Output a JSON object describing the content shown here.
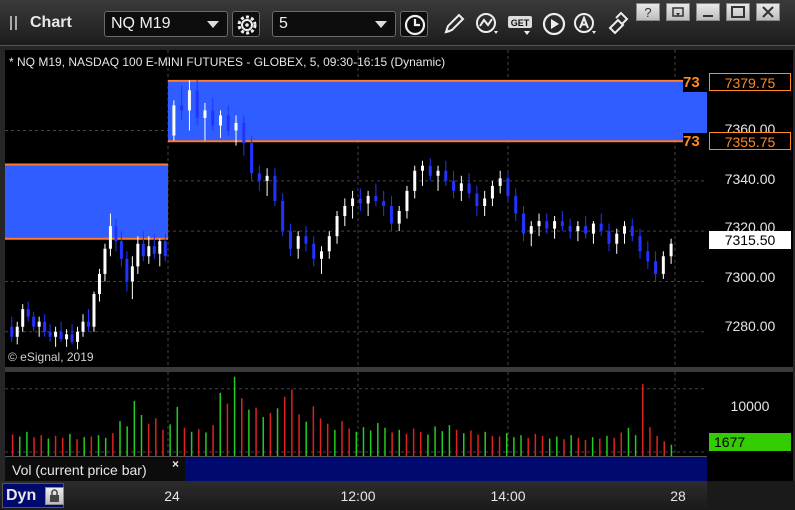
{
  "window": {
    "title": "Chart"
  },
  "toolbar": {
    "symbol": "NQ M19",
    "interval": "5"
  },
  "chart": {
    "description": "* NQ M19, NASDAQ 100 E-MINI FUTURES - GLOBEX, 5, 09:30-16:15 (Dynamic)",
    "copyright": "© eSignal, 2019",
    "price_axis": [
      "7360.00",
      "7340.00",
      "7320.00",
      "7300.00",
      "7280.00"
    ],
    "price_tags": {
      "zone_top": "7379.75",
      "zone_bottom": "7355.75",
      "last": "7315.50",
      "left_marker_top": "73",
      "left_marker_bottom": "73"
    },
    "volume": {
      "label": "Vol (current price bar)",
      "axis_label": "10000",
      "last": "1677",
      "close_symbol": "×"
    },
    "time_axis": [
      "24",
      "12:00",
      "14:00",
      "28"
    ],
    "dyn_label": "Dyn"
  },
  "colors": {
    "up": "#ffffff",
    "down": "#2233ff",
    "zone": "#2f5dff",
    "zone_line": "#ff7a2a",
    "vol_up": "#22cc22",
    "vol_down": "#dd2222",
    "last_vol_tag": "#33cc00"
  },
  "chart_data": {
    "type": "candlestick",
    "title": "* NQ M19, NASDAQ 100 E-MINI FUTURES - GLOBEX, 5, 09:30-16:15 (Dynamic)",
    "y_ticks": [
      7280,
      7300,
      7320,
      7340,
      7360
    ],
    "ylim": [
      7266,
      7392
    ],
    "zones": [
      {
        "top": 7379.75,
        "bottom": 7355.75,
        "x_start": 0.234,
        "x_end": 1.0
      },
      {
        "top": 7346.5,
        "bottom": 7317,
        "x_start": 0.0,
        "x_end": 0.234
      }
    ],
    "last_price": 7315.5,
    "ohlc": [
      [
        7282,
        7286,
        7276,
        7278
      ],
      [
        7278,
        7284,
        7275,
        7282
      ],
      [
        7282,
        7291,
        7280,
        7289
      ],
      [
        7289,
        7292,
        7284,
        7286
      ],
      [
        7286,
        7288,
        7280,
        7282
      ],
      [
        7282,
        7286,
        7278,
        7284
      ],
      [
        7284,
        7287,
        7278,
        7280
      ],
      [
        7280,
        7283,
        7276,
        7278
      ],
      [
        7278,
        7282,
        7274,
        7280
      ],
      [
        7280,
        7284,
        7276,
        7277
      ],
      [
        7277,
        7281,
        7274,
        7279
      ],
      [
        7279,
        7283,
        7275,
        7276
      ],
      [
        7276,
        7282,
        7273,
        7280
      ],
      [
        7280,
        7287,
        7278,
        7284
      ],
      [
        7284,
        7289,
        7280,
        7282
      ],
      [
        7282,
        7296,
        7280,
        7295
      ],
      [
        7295,
        7305,
        7292,
        7303
      ],
      [
        7303,
        7315,
        7300,
        7313
      ],
      [
        7313,
        7327,
        7310,
        7322
      ],
      [
        7322,
        7325,
        7312,
        7316
      ],
      [
        7316,
        7320,
        7306,
        7309
      ],
      [
        7309,
        7312,
        7296,
        7300
      ],
      [
        7300,
        7310,
        7293,
        7306
      ],
      [
        7306,
        7318,
        7303,
        7315
      ],
      [
        7315,
        7320,
        7308,
        7310
      ],
      [
        7310,
        7318,
        7307,
        7314
      ],
      [
        7314,
        7319,
        7309,
        7311
      ],
      [
        7311,
        7317,
        7306,
        7316
      ],
      [
        7316,
        7319,
        7308,
        7310
      ],
      [
        7358,
        7372,
        7356,
        7370
      ],
      [
        7370,
        7378,
        7364,
        7368
      ],
      [
        7368,
        7380,
        7360,
        7376
      ],
      [
        7376,
        7380,
        7362,
        7365
      ],
      [
        7365,
        7371,
        7356,
        7368
      ],
      [
        7368,
        7373,
        7360,
        7362
      ],
      [
        7362,
        7368,
        7357,
        7366
      ],
      [
        7366,
        7370,
        7358,
        7360
      ],
      [
        7360,
        7366,
        7354,
        7363
      ],
      [
        7363,
        7366,
        7350,
        7355
      ],
      [
        7355,
        7358,
        7340,
        7343
      ],
      [
        7343,
        7346,
        7336,
        7340
      ],
      [
        7340,
        7345,
        7334,
        7342
      ],
      [
        7342,
        7345,
        7330,
        7332
      ],
      [
        7332,
        7335,
        7318,
        7320
      ],
      [
        7320,
        7323,
        7310,
        7313
      ],
      [
        7313,
        7320,
        7309,
        7318
      ],
      [
        7318,
        7322,
        7312,
        7315
      ],
      [
        7315,
        7318,
        7306,
        7309
      ],
      [
        7309,
        7314,
        7303,
        7312
      ],
      [
        7312,
        7320,
        7309,
        7318
      ],
      [
        7318,
        7328,
        7315,
        7326
      ],
      [
        7326,
        7333,
        7322,
        7330
      ],
      [
        7330,
        7336,
        7325,
        7333
      ],
      [
        7333,
        7337,
        7328,
        7331
      ],
      [
        7331,
        7336,
        7326,
        7334
      ],
      [
        7334,
        7339,
        7330,
        7332
      ],
      [
        7332,
        7336,
        7326,
        7330
      ],
      [
        7330,
        7334,
        7320,
        7323
      ],
      [
        7323,
        7330,
        7320,
        7328
      ],
      [
        7328,
        7338,
        7325,
        7336
      ],
      [
        7336,
        7346,
        7333,
        7344
      ],
      [
        7344,
        7348,
        7338,
        7346
      ],
      [
        7346,
        7349,
        7340,
        7342
      ],
      [
        7342,
        7346,
        7336,
        7344
      ],
      [
        7344,
        7348,
        7338,
        7340
      ],
      [
        7340,
        7344,
        7333,
        7336
      ],
      [
        7336,
        7342,
        7332,
        7339
      ],
      [
        7339,
        7343,
        7333,
        7335
      ],
      [
        7335,
        7338,
        7326,
        7330
      ],
      [
        7330,
        7336,
        7326,
        7333
      ],
      [
        7333,
        7340,
        7330,
        7338
      ],
      [
        7338,
        7344,
        7335,
        7341
      ],
      [
        7341,
        7343,
        7332,
        7334
      ],
      [
        7334,
        7337,
        7324,
        7327
      ],
      [
        7327,
        7330,
        7316,
        7319
      ],
      [
        7319,
        7324,
        7314,
        7322
      ],
      [
        7322,
        7327,
        7318,
        7324
      ],
      [
        7324,
        7327,
        7319,
        7321
      ],
      [
        7321,
        7326,
        7317,
        7324
      ],
      [
        7324,
        7328,
        7320,
        7322
      ],
      [
        7322,
        7325,
        7317,
        7320
      ],
      [
        7320,
        7324,
        7316,
        7322
      ],
      [
        7322,
        7326,
        7317,
        7319
      ],
      [
        7319,
        7324,
        7315,
        7323
      ],
      [
        7323,
        7327,
        7318,
        7320
      ],
      [
        7320,
        7323,
        7312,
        7315
      ],
      [
        7315,
        7321,
        7311,
        7319
      ],
      [
        7319,
        7324,
        7315,
        7322
      ],
      [
        7322,
        7325,
        7316,
        7318
      ],
      [
        7318,
        7321,
        7309,
        7312
      ],
      [
        7312,
        7316,
        7305,
        7308
      ],
      [
        7308,
        7312,
        7300,
        7303
      ],
      [
        7303,
        7312,
        7301,
        7310
      ],
      [
        7310,
        7317,
        7307,
        7315
      ]
    ],
    "volume_axis_ticks": [
      10000
    ],
    "volume": [
      3200,
      2900,
      3600,
      2800,
      3100,
      2600,
      3000,
      2700,
      3300,
      2500,
      2800,
      2900,
      3100,
      2700,
      3400,
      5200,
      4400,
      8200,
      6100,
      4800,
      5600,
      3900,
      4700,
      7300,
      4200,
      3600,
      4000,
      3500,
      4600,
      9400,
      7800,
      11800,
      8600,
      6900,
      7200,
      5800,
      6400,
      7100,
      8800,
      9900,
      6200,
      5100,
      7400,
      5600,
      4800,
      3900,
      5200,
      4100,
      3600,
      4300,
      3800,
      4900,
      4200,
      3500,
      3900,
      3300,
      4100,
      3600,
      3200,
      4400,
      3700,
      4600,
      3900,
      3400,
      3800,
      3200,
      3600,
      3000,
      2900,
      3400,
      2800,
      3100,
      2700,
      3300,
      3000,
      2600,
      2900,
      2500,
      3100,
      2700,
      2400,
      2800,
      2600,
      3000,
      2700,
      3500,
      4200,
      3100,
      10700,
      4300,
      3000,
      2200,
      1677
    ]
  }
}
